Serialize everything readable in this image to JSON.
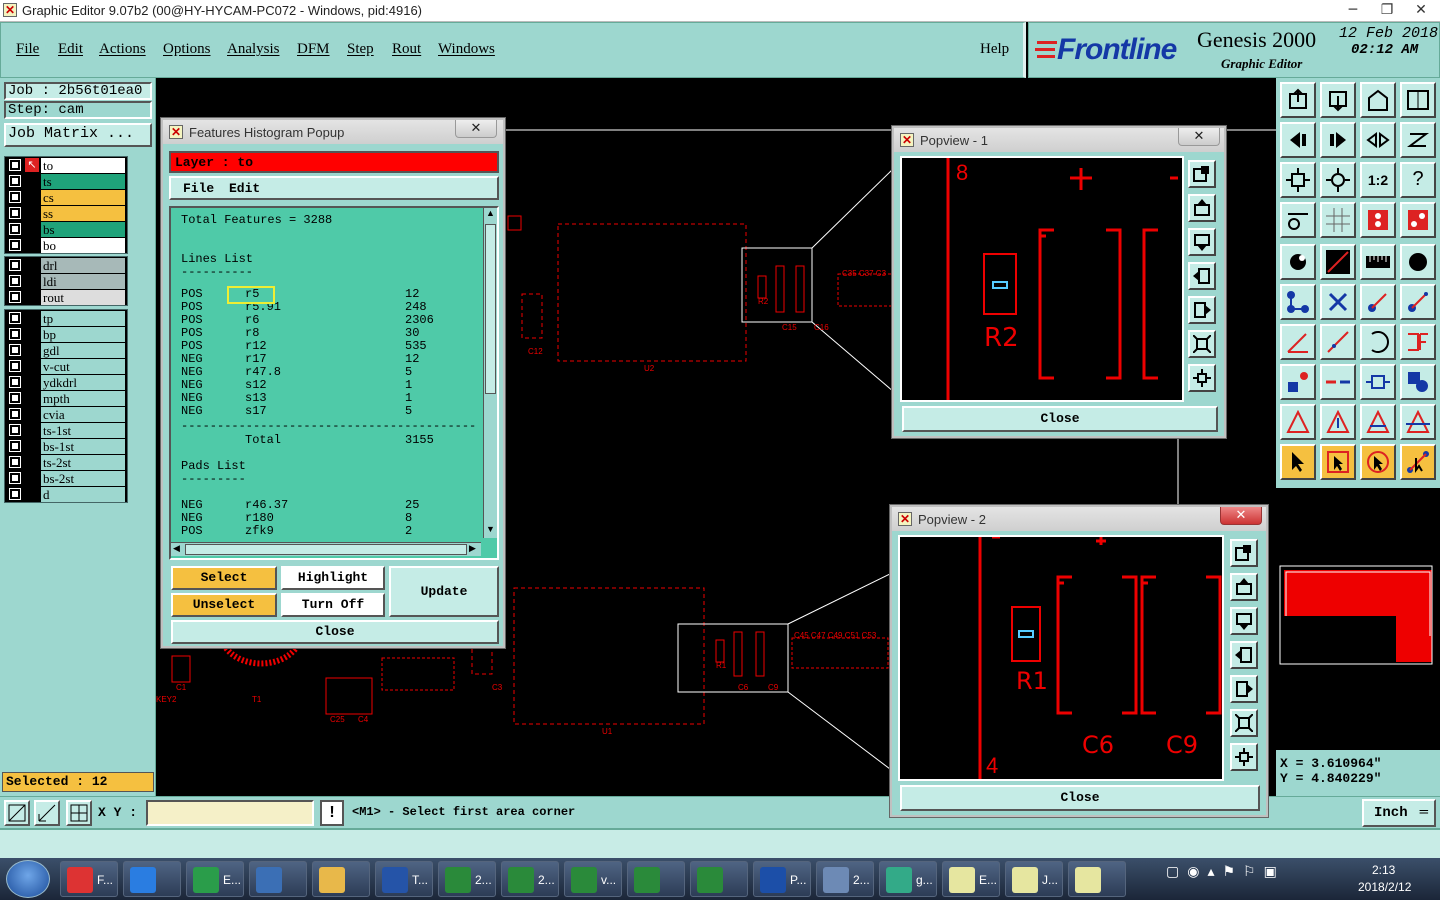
{
  "window": {
    "title": "Graphic Editor 9.07b2 (00@HY-HYCAM-PC072 - Windows, pid:4916)"
  },
  "menu": {
    "items": [
      "File",
      "Edit",
      "Actions",
      "Options",
      "Analysis",
      "DFM",
      "Step",
      "Rout",
      "Windows"
    ],
    "help": "Help"
  },
  "brand": {
    "logo": "Frontline",
    "product": "Genesis 2000",
    "subtitle": "Graphic Editor",
    "date": "12 Feb 2018",
    "time": "02:12 AM"
  },
  "left": {
    "job": "Job : 2b56t01ea0",
    "step": "Step: cam",
    "job_matrix": "Job Matrix ...",
    "selected": "Selected : 12",
    "layers1": [
      {
        "name": "to",
        "color": "#ffffff"
      },
      {
        "name": "ts",
        "color": "#1fa37a"
      },
      {
        "name": "cs",
        "color": "#f5c040"
      },
      {
        "name": "ss",
        "color": "#f5c040"
      },
      {
        "name": "bs",
        "color": "#1fa37a"
      },
      {
        "name": "bo",
        "color": "#ffffff"
      }
    ],
    "layers2": [
      {
        "name": "drl",
        "color": "#a7b9b8"
      },
      {
        "name": "ldi",
        "color": "#a7b9b8"
      },
      {
        "name": "rout",
        "color": "#dddddd"
      }
    ],
    "layers3": [
      {
        "name": "tp",
        "color": "#9dd7cf"
      },
      {
        "name": "bp",
        "color": "#9dd7cf"
      },
      {
        "name": "gdl",
        "color": "#9dd7cf"
      },
      {
        "name": "v-cut",
        "color": "#9dd7cf"
      },
      {
        "name": "ydkdrl",
        "color": "#9dd7cf"
      },
      {
        "name": "mpth",
        "color": "#9dd7cf"
      },
      {
        "name": "cvia",
        "color": "#9dd7cf"
      },
      {
        "name": "ts-1st",
        "color": "#9dd7cf"
      },
      {
        "name": "bs-1st",
        "color": "#9dd7cf"
      },
      {
        "name": "ts-2st",
        "color": "#9dd7cf"
      },
      {
        "name": "bs-2st",
        "color": "#9dd7cf"
      },
      {
        "name": "d",
        "color": "#9dd7cf"
      }
    ]
  },
  "histogram": {
    "title": "Features Histogram Popup",
    "layer": "Layer :  to",
    "menu_file": "File",
    "menu_edit": "Edit",
    "total": "Total Features = 3288",
    "lines_header": "Lines List",
    "dash1": "----------",
    "lines": [
      [
        "POS",
        "r5",
        "12"
      ],
      [
        "POS",
        "r5.91",
        "248"
      ],
      [
        "POS",
        "r6",
        "2306"
      ],
      [
        "POS",
        "r8",
        "30"
      ],
      [
        "POS",
        "r12",
        "535"
      ],
      [
        "NEG",
        "r17",
        "12"
      ],
      [
        "NEG",
        "r47.8",
        "5"
      ],
      [
        "NEG",
        "s12",
        "1"
      ],
      [
        "NEG",
        "s13",
        "1"
      ],
      [
        "NEG",
        "s17",
        "5"
      ]
    ],
    "sep": "-----------------------------------------",
    "total_label": "Total",
    "total_value": "3155",
    "pads_header": "Pads List",
    "dash2": "---------",
    "pads": [
      [
        "NEG",
        "r46.37",
        "25"
      ],
      [
        "NEG",
        "r180",
        "8"
      ],
      [
        "POS",
        "zfk9",
        "2"
      ]
    ],
    "btn_select": "Select",
    "btn_highlight": "Highlight",
    "btn_unselect": "Unselect",
    "btn_turnoff": "Turn Off",
    "btn_update": "Update",
    "btn_close": "Close"
  },
  "popview1": {
    "title": "Popview - 1",
    "num_top": "8",
    "label": "R2",
    "close": "Close"
  },
  "popview2": {
    "title": "Popview - 2",
    "num_bottom": "4",
    "label_r": "R1",
    "label_c6": "C6",
    "label_c9": "C9",
    "close": "Close"
  },
  "coords": {
    "x": "X = 3.610964\"",
    "y": "Y = 4.840229\""
  },
  "status": {
    "xy_label": "X Y :",
    "message": "<M1> - Select first area corner",
    "units": "Inch"
  },
  "canvas_labels": {
    "u2": "U2",
    "u1": "U1",
    "c12": "C12",
    "c3": "C3",
    "r2": "R2",
    "r1": "R1",
    "c15": "C15",
    "c16": "C16",
    "c35": "C35 C37 C3",
    "c45": "C45 C47 C49 C51 C53",
    "c6": "C6",
    "c9": "C9",
    "c1": "C1",
    "c25": "C25",
    "c4": "C4",
    "key2": "KEY2",
    "t1": "T1"
  },
  "taskbar": {
    "items": [
      "F...",
      "",
      "E...",
      "",
      "",
      "T...",
      "2...",
      "2...",
      "v...",
      "",
      "",
      "P...",
      "2...",
      "g...",
      "E...",
      "J...",
      ""
    ],
    "clock_time": "2:13",
    "clock_date": "2018/2/12"
  }
}
